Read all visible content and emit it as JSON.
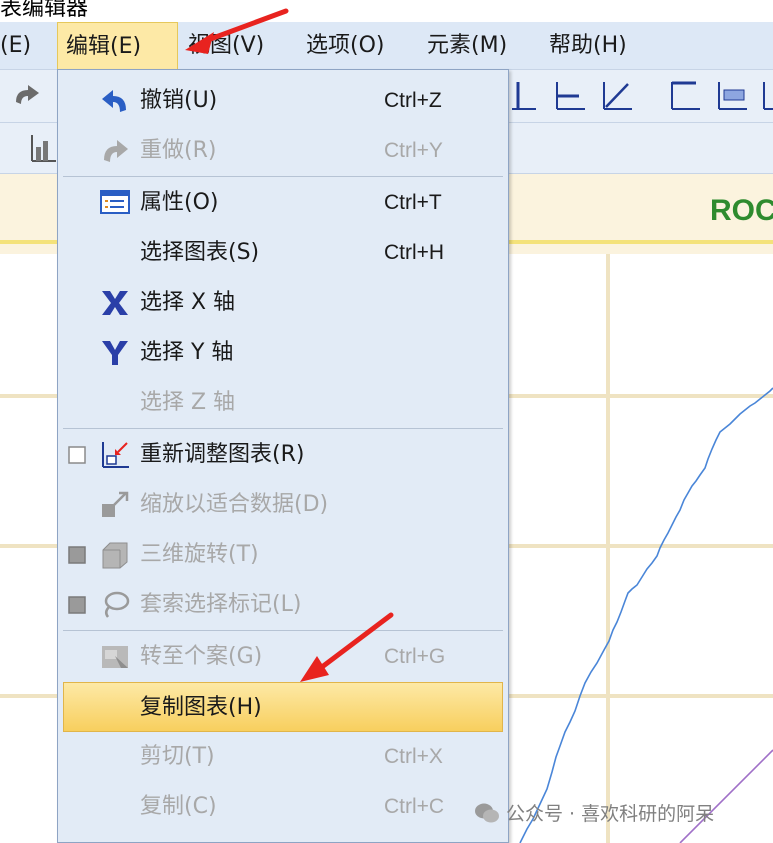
{
  "window": {
    "title_partial": "表编辑器"
  },
  "menubar": {
    "items": [
      {
        "label": "(E)"
      },
      {
        "label": "编辑(E)"
      },
      {
        "label": "视图(V)"
      },
      {
        "label": "选项(O)"
      },
      {
        "label": "元素(M)"
      },
      {
        "label": "帮助(H)"
      }
    ]
  },
  "chart": {
    "title_partial": "ROC"
  },
  "edit_menu": {
    "items": [
      {
        "label": "撤销(U)",
        "shortcut": "Ctrl+Z",
        "enabled": true,
        "icon": "undo-icon"
      },
      {
        "label": "重做(R)",
        "shortcut": "Ctrl+Y",
        "enabled": false,
        "icon": "redo-icon"
      },
      {
        "label": "属性(O)",
        "shortcut": "Ctrl+T",
        "enabled": true,
        "icon": "properties-icon"
      },
      {
        "label": "选择图表(S)",
        "shortcut": "Ctrl+H",
        "enabled": true
      },
      {
        "label": "选择 X 轴",
        "enabled": true,
        "icon": "x-axis-icon"
      },
      {
        "label": "选择 Y 轴",
        "enabled": true,
        "icon": "y-axis-icon"
      },
      {
        "label": "选择 Z 轴",
        "enabled": false
      },
      {
        "label": "重新调整图表(R)",
        "enabled": true,
        "checked": false,
        "icon": "rescale-chart-icon"
      },
      {
        "label": "缩放以适合数据(D)",
        "enabled": false,
        "icon": "scale-to-fit-icon"
      },
      {
        "label": "三维旋转(T)",
        "enabled": false,
        "checked": false,
        "icon": "3d-rotate-icon"
      },
      {
        "label": "套索选择标记(L)",
        "enabled": false,
        "checked": false,
        "icon": "lasso-icon"
      },
      {
        "label": "转至个案(G)",
        "shortcut": "Ctrl+G",
        "enabled": false,
        "icon": "goto-case-icon"
      },
      {
        "label": "复制图表(H)",
        "enabled": true,
        "highlighted": true
      },
      {
        "label": "剪切(T)",
        "shortcut": "Ctrl+X",
        "enabled": false
      },
      {
        "label": "复制(C)",
        "shortcut": "Ctrl+C",
        "enabled": false
      }
    ]
  },
  "watermark": {
    "text": "公众号 · 喜欢科研的阿呆"
  },
  "colors": {
    "menubar_bg": "#dde8f6",
    "menu_bg": "#e2ebf6",
    "highlight": "#f8cf5e",
    "annotation_arrow": "#e8231f",
    "roc_curve": "#4a86d8",
    "reference_line": "#a070c8",
    "chart_title": "#2e8b2e"
  }
}
